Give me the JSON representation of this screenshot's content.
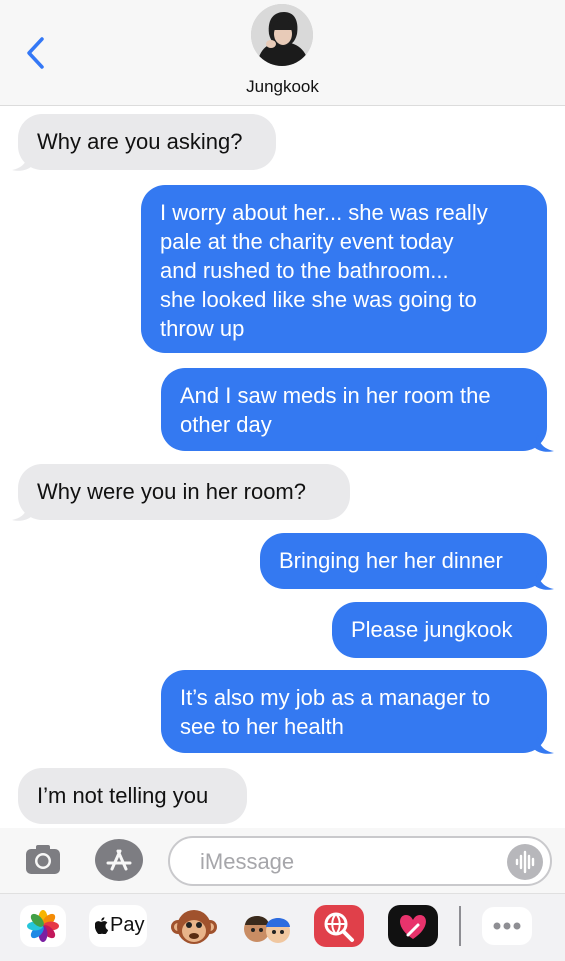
{
  "header": {
    "contact_name": "Jungkook"
  },
  "messages": [
    {
      "direction": "incoming",
      "text": "Why are you asking?"
    },
    {
      "direction": "outgoing",
      "lines": [
        "I worry about her... she was really",
        "pale at the charity event today",
        "and rushed to the bathroom...",
        "she looked like she was going to",
        "throw up"
      ]
    },
    {
      "direction": "outgoing",
      "lines": [
        "And I saw meds in her room the",
        "other day"
      ]
    },
    {
      "direction": "incoming",
      "text": "Why were you in her room?"
    },
    {
      "direction": "outgoing",
      "text": "Bringing her her dinner"
    },
    {
      "direction": "outgoing",
      "text": "Please jungkook"
    },
    {
      "direction": "outgoing",
      "lines": [
        "It’s also my job as a manager to",
        "see to her health"
      ]
    },
    {
      "direction": "incoming",
      "text": "I’m not telling you"
    }
  ],
  "composer": {
    "placeholder": "iMessage"
  },
  "apps": {
    "apple_pay_label": "Pay"
  },
  "colors": {
    "outgoing": "#3479f1",
    "incoming": "#e9e9eb",
    "accent": "#3478f6"
  }
}
